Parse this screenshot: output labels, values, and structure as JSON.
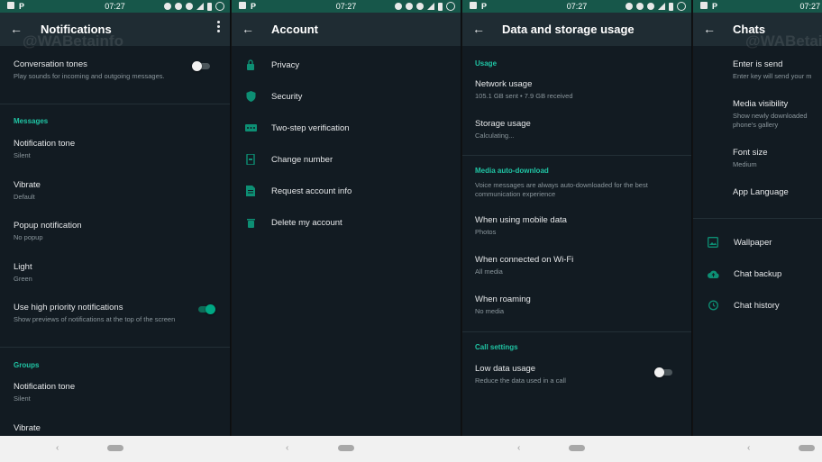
{
  "status_bar": {
    "time": "07:27"
  },
  "watermark": "@WABetainfo",
  "colors": {
    "accent": "#20c4a4",
    "status_bar": "#17574a",
    "app_bar": "#1f2c33",
    "background": "#121b22"
  },
  "notifications": {
    "title": "Notifications",
    "items": {
      "conversation_tones": {
        "title": "Conversation tones",
        "subtitle": "Play sounds for incoming and outgoing messages.",
        "enabled": false
      },
      "messages_header": "Messages",
      "msg_tone": {
        "title": "Notification tone",
        "subtitle": "Silent"
      },
      "msg_vibrate": {
        "title": "Vibrate",
        "subtitle": "Default"
      },
      "msg_popup": {
        "title": "Popup notification",
        "subtitle": "No popup"
      },
      "msg_light": {
        "title": "Light",
        "subtitle": "Green"
      },
      "high_priority": {
        "title": "Use high priority notifications",
        "subtitle": "Show previews of notifications at the top of the screen",
        "enabled": true
      },
      "groups_header": "Groups",
      "grp_tone": {
        "title": "Notification tone",
        "subtitle": "Silent"
      },
      "grp_vibrate": {
        "title": "Vibrate"
      }
    }
  },
  "account": {
    "title": "Account",
    "items": [
      {
        "label": "Privacy",
        "icon": "lock-icon"
      },
      {
        "label": "Security",
        "icon": "shield-icon"
      },
      {
        "label": "Two-step verification",
        "icon": "dots-icon"
      },
      {
        "label": "Change number",
        "icon": "phone-change-icon"
      },
      {
        "label": "Request account info",
        "icon": "document-icon"
      },
      {
        "label": "Delete my account",
        "icon": "trash-icon"
      }
    ]
  },
  "data_storage": {
    "title": "Data and storage usage",
    "usage_header": "Usage",
    "network": {
      "title": "Network usage",
      "subtitle": "105.1 GB sent • 7.9 GB received"
    },
    "storage": {
      "title": "Storage usage",
      "subtitle": "Calculating..."
    },
    "auto_header": "Media auto-download",
    "auto_note": "Voice messages are always auto-downloaded for the best communication experience",
    "mobile": {
      "title": "When using mobile data",
      "subtitle": "Photos"
    },
    "wifi": {
      "title": "When connected on Wi-Fi",
      "subtitle": "All media"
    },
    "roaming": {
      "title": "When roaming",
      "subtitle": "No media"
    },
    "call_header": "Call settings",
    "low_data": {
      "title": "Low data usage",
      "subtitle": "Reduce the data used in a call",
      "enabled": false
    }
  },
  "chats": {
    "title": "Chats",
    "enter_send": {
      "title": "Enter is send",
      "subtitle": "Enter key will send your m"
    },
    "media_visibility": {
      "title": "Media visibility",
      "subtitle": "Show newly downloaded",
      "subtitle2": "phone's gallery"
    },
    "font_size": {
      "title": "Font size",
      "subtitle": "Medium"
    },
    "app_language": {
      "title": "App Language"
    },
    "wallpaper": {
      "label": "Wallpaper"
    },
    "backup": {
      "label": "Chat backup"
    },
    "history": {
      "label": "Chat history"
    }
  }
}
